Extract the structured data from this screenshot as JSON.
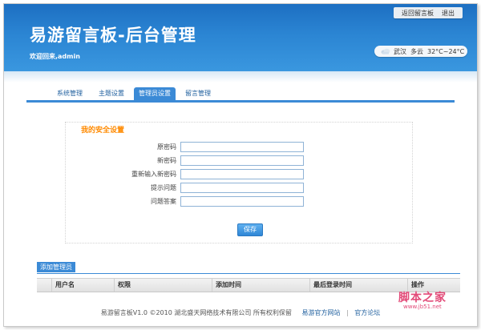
{
  "header": {
    "title": "易游留言板-后台管理",
    "welcome": "欢迎回来,admin",
    "top_links": [
      "返回留言板",
      "退出"
    ],
    "weather": {
      "city": "武汉",
      "condition": "多云",
      "temperature": "32°C~24°C",
      "icon": "cloud-icon"
    }
  },
  "tabs": [
    {
      "label": "系统管理"
    },
    {
      "label": "主题设置"
    },
    {
      "label": "管理员设置",
      "active": true
    },
    {
      "label": "留言管理"
    }
  ],
  "security_form": {
    "title": "我的安全设置",
    "fields": [
      {
        "label": "原密码",
        "value": ""
      },
      {
        "label": "新密码",
        "value": ""
      },
      {
        "label": "重新输入新密码",
        "value": ""
      },
      {
        "label": "提示问题",
        "value": ""
      },
      {
        "label": "问题答案",
        "value": ""
      }
    ],
    "save_label": "保存"
  },
  "admin_table": {
    "add_label": "添加管理员",
    "columns": [
      "用户名",
      "权限",
      "添加时间",
      "最后登录时间",
      "操作"
    ]
  },
  "footer": {
    "text": "易游留言板V1.0 ©2010 湖北盛天网络技术有限公司 所有权利保留",
    "links": [
      "易游官方网站",
      "官方论坛"
    ]
  },
  "watermark": {
    "main": "脚本之家",
    "sub": "www.jb51.net"
  },
  "colors": {
    "header_blue": "#2b85d3",
    "tab_active": "#3b8ad6",
    "section_title_orange": "#ff8a00",
    "watermark_pink": "#e24a78"
  }
}
